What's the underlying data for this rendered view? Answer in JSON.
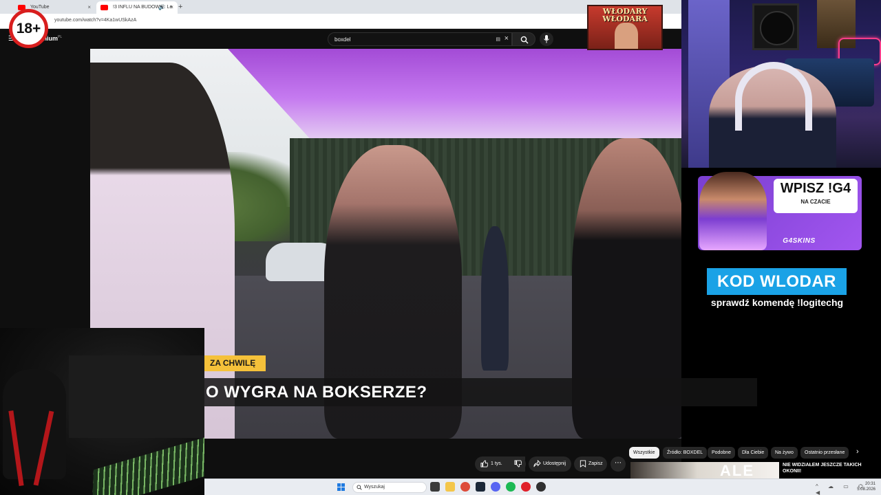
{
  "browser": {
    "tabs": [
      {
        "label": "YouTube"
      },
      {
        "label": "!3 INFLU NA BUDOWIE: Le"
      }
    ],
    "new_tab": "+",
    "close": "×",
    "address": "youtube.com/watch?v=4Ka1wUSkAzA"
  },
  "youtube": {
    "logo_text": "mium",
    "logo_region": "PL",
    "search_value": "boxdel",
    "video_badge": "ZA CHWILĘ",
    "video_title_overlay": "O WYGRA NA BOKSERZE?",
    "actions": {
      "like_count": "1 tys.",
      "share": "Udostępnij",
      "save": "Zapisz",
      "more": "⋯"
    },
    "chips": [
      "Wszystkie",
      "Źródło: BOXDEL",
      "Podobne",
      "Dla Ciebie",
      "Na żywo",
      "Ostatnio przesłane"
    ],
    "chip_next": "›",
    "suggestion": {
      "thumb_text": "ALE",
      "title": "NIE WIDZIAŁEM JESZCZE TAKICH OKONII!"
    }
  },
  "overlay": {
    "age_badge": "18+",
    "channel_logo": "WŁODARY WŁODARA",
    "sponsor": {
      "headline": "WPISZ !G4",
      "sub": "NA CZACIE",
      "brand": "G4SKINS"
    },
    "code_box": "KOD WLODAR",
    "code_hint": "sprawdź komendę !logitechg"
  },
  "taskbar": {
    "search_placeholder": "Wyszukaj",
    "time": "20:31",
    "date": "5.08.2026"
  },
  "colors": {
    "yt_red": "#ff0000",
    "badge_yellow": "#f5c13a",
    "code_blue": "#1aa2e6",
    "sponsor_purple": "#a256f0",
    "age_red": "#d81e1e"
  }
}
